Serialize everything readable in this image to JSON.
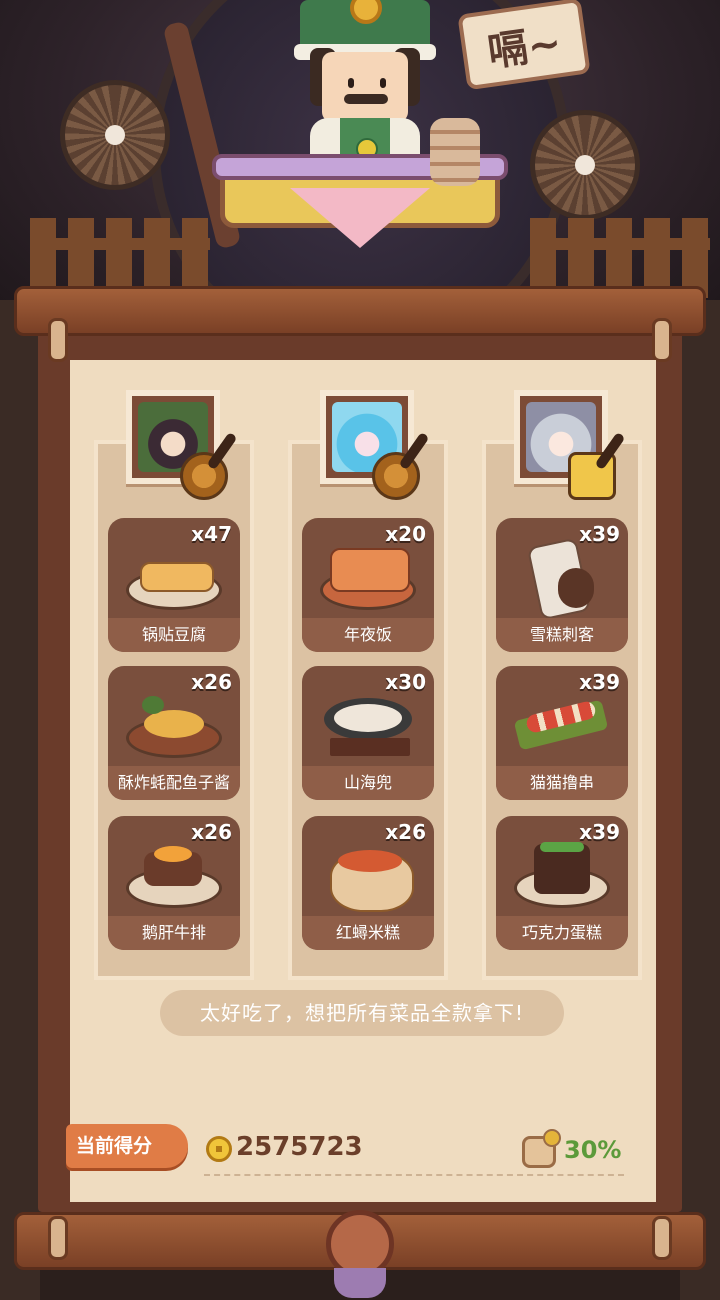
{
  "speech_bubble": "嗝~",
  "columns": [
    {
      "dishes": [
        {
          "name": "锅贴豆腐",
          "count": "x47"
        },
        {
          "name": "酥炸蚝配鱼子酱",
          "count": "x26"
        },
        {
          "name": "鹅肝牛排",
          "count": "x26"
        }
      ]
    },
    {
      "dishes": [
        {
          "name": "年夜饭",
          "count": "x20"
        },
        {
          "name": "山海兜",
          "count": "x30"
        },
        {
          "name": "红蟳米糕",
          "count": "x26"
        }
      ]
    },
    {
      "dishes": [
        {
          "name": "雪糕刺客",
          "count": "x39"
        },
        {
          "name": "猫猫撸串",
          "count": "x39"
        },
        {
          "name": "巧克力蛋糕",
          "count": "x39"
        }
      ]
    }
  ],
  "message": "太好吃了，想把所有菜品全款拿下!",
  "score_label": "当前得分",
  "score_value": "2575723",
  "bonus_percent": "30%",
  "colors": {
    "accent": "#e07c46",
    "bonus_green": "#5c9a3a",
    "card_bg": "#7a4f3d",
    "paper": "#efdcc0"
  }
}
